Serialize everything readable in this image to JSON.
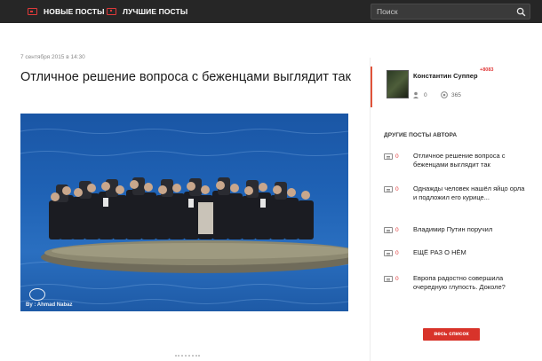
{
  "nav": {
    "items": [
      {
        "label": "НОВЫЕ ПОСТЫ",
        "icon": "posts-icon"
      },
      {
        "label": "ЛУЧШИЕ ПОСТЫ",
        "icon": "best-icon"
      }
    ],
    "search": {
      "placeholder": "Поиск",
      "icon": "search-icon"
    }
  },
  "post": {
    "date": "7 сентября 2015 в 14:30",
    "title": "Отличное решение вопроса с беженцами выглядит так",
    "image": {
      "description_icon": "photo",
      "watermark": "By : Ahmad Nabaz"
    }
  },
  "sidebar": {
    "author": {
      "name": "Константин Суппер",
      "karma": "+8083",
      "stat_likes": "0",
      "stat_views": "365"
    },
    "other_posts_title": "ДРУГИЕ ПОСТЫ АВТОРА",
    "other_posts": [
      {
        "count": "0",
        "title": "Отличное решение вопроса с беженцами выглядит так"
      },
      {
        "count": "0",
        "title": "Однажды человек нашёл яйцо орла и подложил его курице..."
      },
      {
        "count": "0",
        "title": "Владимир Путин поручил"
      },
      {
        "count": "0",
        "title": "ЕЩЁ РАЗ О НЁМ"
      },
      {
        "count": "0",
        "title": "Европа радостно совершила очередную глупость. Доколе?"
      }
    ],
    "all_list_label": "весь список"
  },
  "colors": {
    "topbar": "#262626",
    "accent": "#e03a3a",
    "button": "#d8332a",
    "sea": "#1f62b5"
  }
}
